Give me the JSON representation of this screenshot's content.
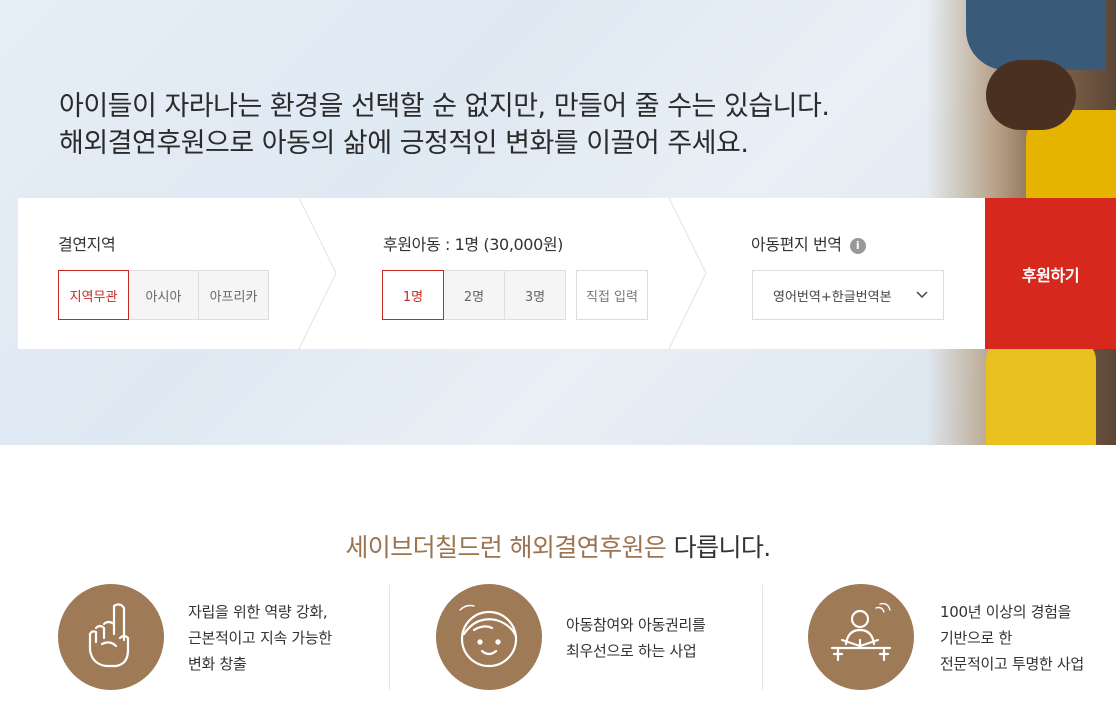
{
  "hero": {
    "line1": "아이들이 자라나는 환경을 선택할 순 없지만, 만들어 줄 수는 있습니다.",
    "line2": "해외결연후원으로 아동의 삶에 긍정적인 변화를 이끌어 주세요."
  },
  "form": {
    "region": {
      "title": "결연지역",
      "options": [
        "지역무관",
        "아시아",
        "아프리카"
      ],
      "selected": "지역무관"
    },
    "children": {
      "title": "후원아동 : 1명 (30,000원)",
      "options": [
        "1명",
        "2명",
        "3명"
      ],
      "selected": "1명",
      "direct_input": "직접 입력"
    },
    "letter": {
      "title": "아동편지 번역",
      "info_icon": "i",
      "select_value": "영어번역+한글번역본"
    },
    "submit_label": "후원하기"
  },
  "colors": {
    "accent_red": "#d6281d",
    "brand_brown": "#9e7a56",
    "selected_border": "#c8281e"
  },
  "intro": {
    "brand": "세이브더칠드런 해외결연후원은",
    "rest": " 다릅니다."
  },
  "features": [
    {
      "icon": "finger-up-icon",
      "lines": [
        "자립을 위한 역량 강화,",
        "근본적이고 지속 가능한",
        "변화 창출"
      ]
    },
    {
      "icon": "child-face-icon",
      "lines": [
        "아동참여와 아동권리를",
        "최우선으로 하는 사업"
      ]
    },
    {
      "icon": "reading-person-icon",
      "lines": [
        "100년 이상의 경험을",
        "기반으로 한",
        "전문적이고 투명한 사업"
      ]
    }
  ]
}
